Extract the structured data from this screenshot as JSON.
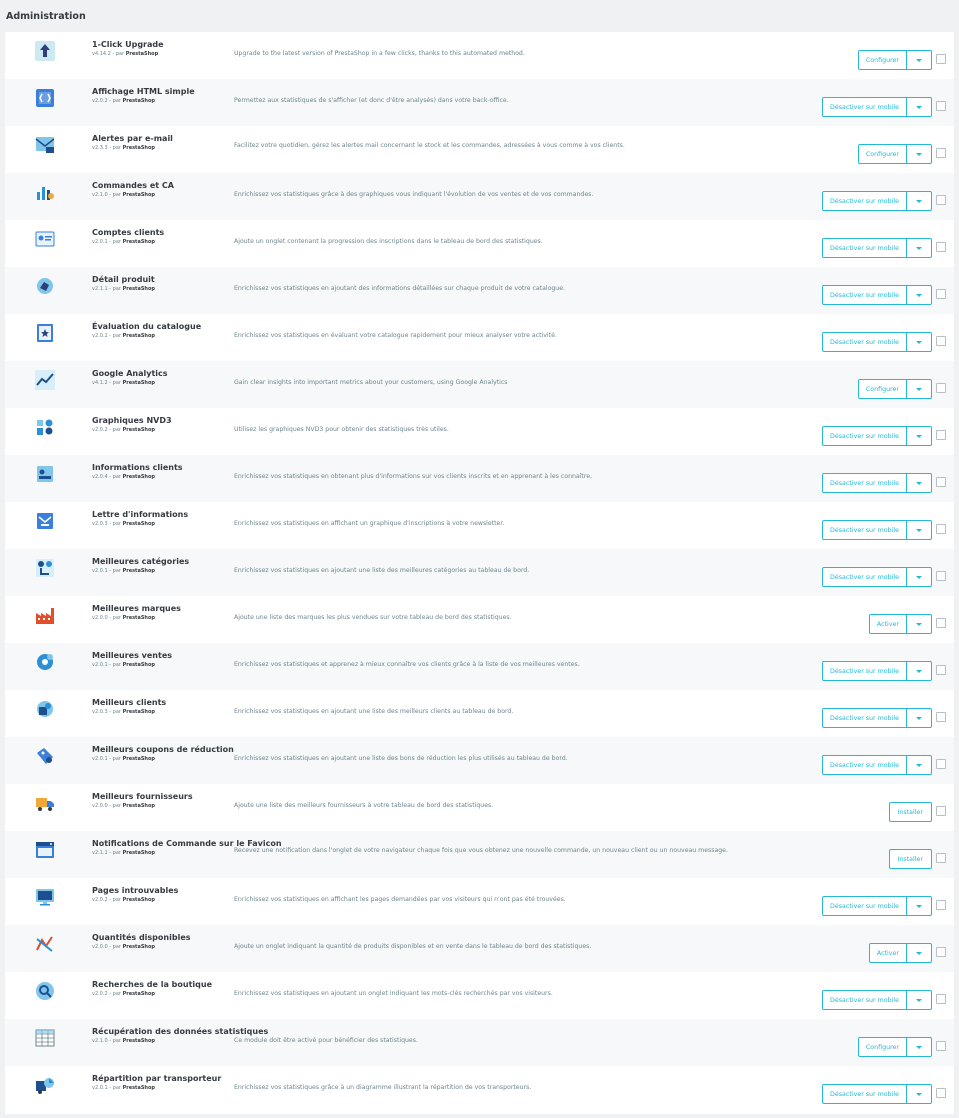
{
  "section_title": "Administration",
  "by_label": "par",
  "brand": "PrestaShop",
  "colors": {
    "accent": "#25b9d7",
    "text": "#363a41",
    "muted": "#6c868e",
    "alt_row": "#f6f8f9"
  },
  "modules": [
    {
      "name": "1-Click Upgrade",
      "version": "v4.14.2",
      "desc": "Upgrade to the latest version of PrestaShop in a few clicks, thanks to this automated method.",
      "action": "Configurer",
      "dropdown": true,
      "icon": "upgrade-icon"
    },
    {
      "name": "Affichage HTML simple",
      "version": "v2.0.2",
      "desc": "Permettez aux statistiques de s'afficher (et donc d'être analysés) dans votre back-office.",
      "action": "Désactiver sur mobile",
      "dropdown": true,
      "icon": "html-display-icon"
    },
    {
      "name": "Alertes par e-mail",
      "version": "v2.3.3",
      "desc": "Facilitez votre quotidien, gérez les alertes mail concernant le stock et les commandes, adressées à vous comme à vos clients.",
      "action": "Configurer",
      "dropdown": true,
      "icon": "mail-alert-icon"
    },
    {
      "name": "Commandes et CA",
      "version": "v2.1.0",
      "desc": "Enrichissez vos statistiques grâce à des graphiques vous indiquant l'évolution de vos ventes et de vos commandes.",
      "action": "Désactiver sur mobile",
      "dropdown": true,
      "icon": "sales-chart-icon"
    },
    {
      "name": "Comptes clients",
      "version": "v2.0.1",
      "desc": "Ajoute un onglet contenant la progression des inscriptions dans le tableau de bord des statistiques.",
      "action": "Désactiver sur mobile",
      "dropdown": true,
      "icon": "customer-accounts-icon"
    },
    {
      "name": "Détail produit",
      "version": "v2.1.1",
      "desc": "Enrichissez vos statistiques en ajoutant des informations détaillées sur chaque produit de votre catalogue.",
      "action": "Désactiver sur mobile",
      "dropdown": true,
      "icon": "product-detail-icon"
    },
    {
      "name": "Évaluation du catalogue",
      "version": "v2.0.2",
      "desc": "Enrichissez vos statistiques en évaluant votre catalogue rapidement pour mieux analyser votre activité.",
      "action": "Désactiver sur mobile",
      "dropdown": true,
      "icon": "catalog-eval-icon"
    },
    {
      "name": "Google Analytics",
      "version": "v4.1.2",
      "desc": "Gain clear insights into important metrics about your customers, using Google Analytics",
      "action": "Configurer",
      "dropdown": true,
      "icon": "analytics-icon"
    },
    {
      "name": "Graphiques NVD3",
      "version": "v2.0.2",
      "desc": "Utilisez les graphiques NVD3 pour obtenir des statistiques très utiles.",
      "action": "Désactiver sur mobile",
      "dropdown": true,
      "icon": "nvd3-chart-icon"
    },
    {
      "name": "Informations clients",
      "version": "v2.0.4",
      "desc": "Enrichissez vos statistiques en obtenant plus d'informations sur vos clients inscrits et en apprenant à les connaître.",
      "action": "Désactiver sur mobile",
      "dropdown": true,
      "icon": "customer-info-icon"
    },
    {
      "name": "Lettre d'informations",
      "version": "v2.0.3",
      "desc": "Enrichissez vos statistiques en affichant un graphique d'inscriptions à votre newsletter.",
      "action": "Désactiver sur mobile",
      "dropdown": true,
      "icon": "newsletter-icon"
    },
    {
      "name": "Meilleures catégories",
      "version": "v2.0.1",
      "desc": "Enrichissez vos statistiques en ajoutant une liste des meilleures catégories au tableau de bord.",
      "action": "Désactiver sur mobile",
      "dropdown": true,
      "icon": "best-categories-icon"
    },
    {
      "name": "Meilleures marques",
      "version": "v2.0.0",
      "desc": "Ajoute une liste des marques les plus vendues sur votre tableau de bord des statistiques.",
      "action": "Activer",
      "dropdown": true,
      "icon": "best-brands-icon"
    },
    {
      "name": "Meilleures ventes",
      "version": "v2.0.1",
      "desc": "Enrichissez vos statistiques et apprenez à mieux connaître vos clients grâce à la liste de vos meilleures ventes.",
      "action": "Désactiver sur mobile",
      "dropdown": true,
      "icon": "best-sales-icon"
    },
    {
      "name": "Meilleurs clients",
      "version": "v2.0.3",
      "desc": "Enrichissez vos statistiques en ajoutant une liste des meilleurs clients au tableau de bord.",
      "action": "Désactiver sur mobile",
      "dropdown": true,
      "icon": "best-customers-icon"
    },
    {
      "name": "Meilleurs coupons de réduction",
      "version": "v2.0.1",
      "desc": "Enrichissez vos statistiques en ajoutant une liste des bons de réduction les plus utilisés au tableau de bord.",
      "action": "Désactiver sur mobile",
      "dropdown": true,
      "icon": "coupon-icon"
    },
    {
      "name": "Meilleurs fournisseurs",
      "version": "v2.0.0",
      "desc": "Ajoute une liste des meilleurs fournisseurs à votre tableau de bord des statistiques.",
      "action": "Installer",
      "dropdown": false,
      "icon": "suppliers-truck-icon"
    },
    {
      "name": "Notifications de Commande sur le Favicon",
      "version": "v2.1.1",
      "desc": "Recevez une notification dans l'onglet de votre navigateur chaque fois que vous obtenez une nouvelle commande, un nouveau client ou un nouveau message.",
      "action": "Installer",
      "dropdown": false,
      "icon": "favicon-notification-icon"
    },
    {
      "name": "Pages introuvables",
      "version": "v2.0.2",
      "desc": "Enrichissez vos statistiques en affichant les pages demandées par vos visiteurs qui n'ont pas été trouvées.",
      "action": "Désactiver sur mobile",
      "dropdown": true,
      "icon": "page-404-icon"
    },
    {
      "name": "Quantités disponibles",
      "version": "v2.0.0",
      "desc": "Ajoute un onglet indiquant la quantité de produits disponibles et en vente dans le tableau de bord des statistiques.",
      "action": "Activer",
      "dropdown": true,
      "icon": "stock-quantity-icon"
    },
    {
      "name": "Recherches de la boutique",
      "version": "v2.0.2",
      "desc": "Enrichissez vos statistiques en ajoutant un onglet indiquant les mots-clés recherchés par vos visiteurs.",
      "action": "Désactiver sur mobile",
      "dropdown": true,
      "icon": "shop-search-icon"
    },
    {
      "name": "Récupération des données statistiques",
      "version": "v2.1.0",
      "desc": "Ce module doit être activé pour bénéficier des statistiques.",
      "action": "Configurer",
      "dropdown": true,
      "icon": "data-table-icon"
    },
    {
      "name": "Répartition par transporteur",
      "version": "v2.0.1",
      "desc": "Enrichissez vos statistiques grâce à un diagramme illustrant la répartition de vos transporteurs.",
      "action": "Désactiver sur mobile",
      "dropdown": true,
      "icon": "carrier-distribution-icon"
    }
  ]
}
